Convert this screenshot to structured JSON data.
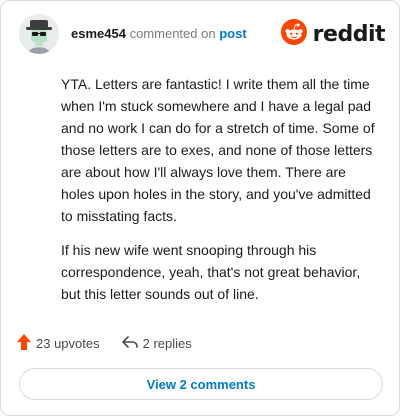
{
  "colors": {
    "link": "#0079d3",
    "upvote": "#ff4500",
    "border": "#d7dadc",
    "muted": "#7c7c7c"
  },
  "header": {
    "username": "esme454",
    "verb": "commented on",
    "target": "post",
    "brand": "reddit",
    "avatar_icon": "avatar-icon",
    "brand_icon": "reddit-alien-icon"
  },
  "comment": {
    "paragraphs": [
      "YTA. Letters are fantastic! I write them all the time when I'm stuck somewhere and I have a legal pad and no work I can do for a stretch of time. Some of those letters are to exes, and none of those letters are about how I'll always love them. There are holes upon holes in the story, and you've admitted to misstating facts.",
      "If his new wife went snooping through his correspondence, yeah, that's not great behavior, but this letter sounds out of line."
    ]
  },
  "actions": {
    "upvotes": "23 upvotes",
    "replies": "2 replies",
    "upvote_icon": "upvote-arrow-icon",
    "reply_icon": "reply-arrow-icon"
  },
  "footer": {
    "view_comments": "View 2 comments"
  }
}
